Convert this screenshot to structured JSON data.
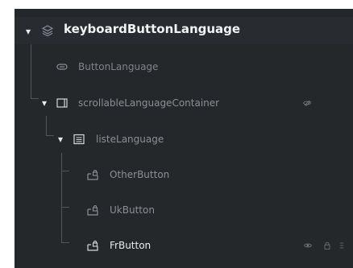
{
  "tree": {
    "root": {
      "label": "keyboardButtonLanguage",
      "icon": "layers-icon",
      "expanded": true
    },
    "items": [
      {
        "label": "ButtonLanguage",
        "icon": "button-icon",
        "expanded": false
      },
      {
        "label": "scrollableLanguageContainer",
        "icon": "container-icon",
        "expanded": true
      },
      {
        "label": "listeLanguage",
        "icon": "list-icon",
        "expanded": true
      },
      {
        "label": "OtherButton",
        "icon": "lock-button-icon",
        "expanded": false
      },
      {
        "label": "UkButton",
        "icon": "lock-button-icon",
        "expanded": false
      },
      {
        "label": "FrButton",
        "icon": "lock-button-icon",
        "expanded": false
      }
    ]
  },
  "colors": {
    "panel": "#25282B",
    "header": "#282B2F",
    "text_primary": "#F2F3F5",
    "text_secondary": "#8B9096",
    "line": "#50555A"
  }
}
